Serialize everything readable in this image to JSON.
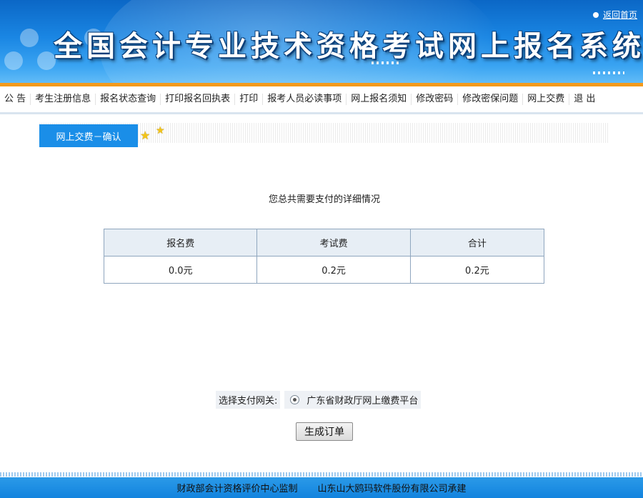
{
  "header": {
    "title": "全国会计专业技术资格考试网上报名系统",
    "home_link": "返回首页"
  },
  "nav": {
    "items": [
      "公 告",
      "考生注册信息",
      "报名状态查询",
      "打印报名回执表",
      "打印",
      "报考人员必读事项",
      "网上报名须知",
      "修改密码",
      "修改密保问题",
      "网上交费",
      "退 出"
    ]
  },
  "section": {
    "tab_label": "网上交费－确认"
  },
  "summary": {
    "text": "您总共需要支付的详细情况"
  },
  "fees": {
    "headers": [
      "报名费",
      "考试费",
      "合计"
    ],
    "values": [
      "0.0元",
      "0.2元",
      "0.2元"
    ]
  },
  "gateway": {
    "label": "选择支付网关:",
    "option": "广东省财政厅网上缴费平台",
    "selected": true
  },
  "submit": {
    "label": "生成订单"
  },
  "footer": {
    "supervisor": "财政部会计资格评价中心监制",
    "builder": "山东山大鸥玛软件股份有限公司承建"
  },
  "colors": {
    "banner": "#1a86e3",
    "accent_bar": "#f39a1c",
    "tab": "#1a8ee8",
    "footer": "#1283de"
  }
}
